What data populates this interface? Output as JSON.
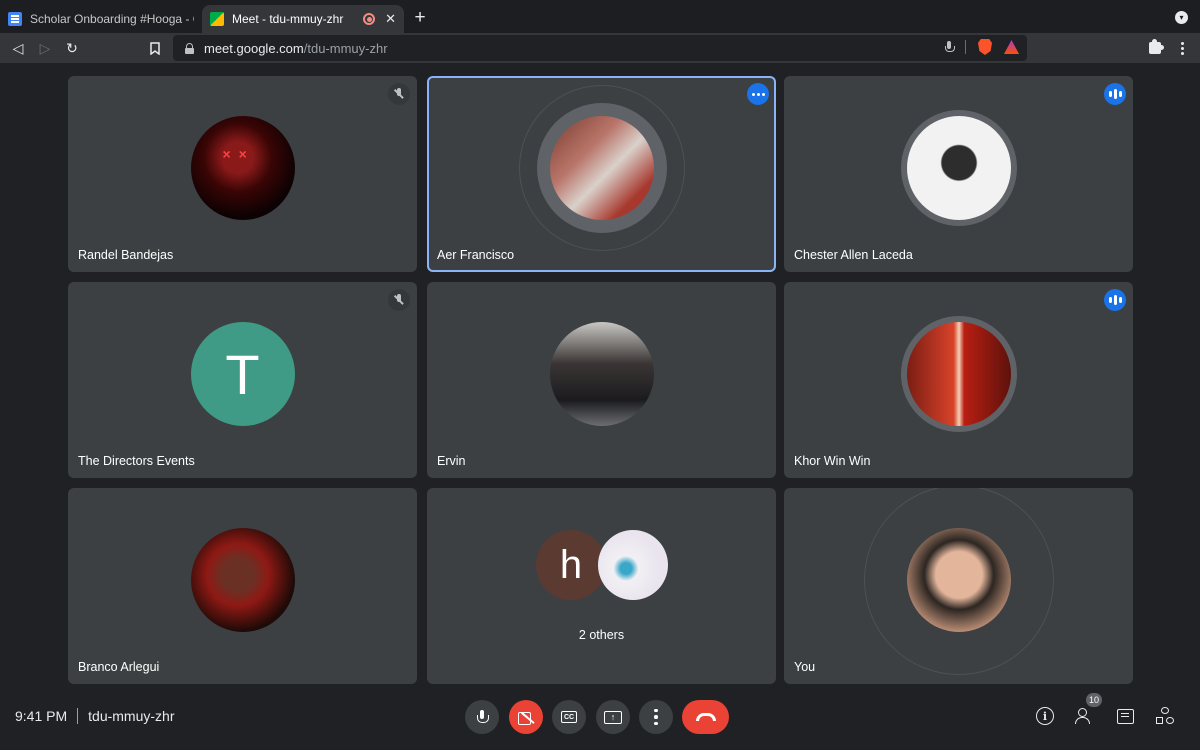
{
  "browser": {
    "tabs": [
      {
        "title": "Scholar Onboarding #Hooga - Goog",
        "icon": "google-docs-icon",
        "active": false
      },
      {
        "title": "Meet - tdu-mmuy-zhr",
        "icon": "google-meet-icon",
        "active": true,
        "close": "✕"
      }
    ],
    "new_tab": "+",
    "url": {
      "host": "meet.google.com",
      "path": "/tdu-mmuy-zhr"
    },
    "nav": {
      "back": "◁",
      "forward": "▷",
      "reload": "↻",
      "bookmark": "⊓"
    }
  },
  "participants": [
    {
      "name": "Randel Bandejas",
      "avatar": "photo",
      "status": "muted"
    },
    {
      "name": "Aer Francisco",
      "avatar": "photo",
      "status": "more",
      "speaking": true
    },
    {
      "name": "Chester Allen Laceda",
      "avatar": "photo",
      "status": "speaking-audio"
    },
    {
      "name": "The Directors Events",
      "avatar": "T",
      "avatar_color": "#3f9a86",
      "status": "muted"
    },
    {
      "name": "Ervin",
      "avatar": "photo",
      "status": "none"
    },
    {
      "name": "Khor Win Win",
      "avatar": "photo",
      "status": "speaking-audio"
    },
    {
      "name": "Branco Arlegui",
      "avatar": "photo",
      "status": "none"
    },
    {
      "name": "2 others",
      "avatar": "h",
      "avatar_color": "#5b3a32",
      "status": "none"
    },
    {
      "name": "You",
      "avatar": "photo",
      "status": "none"
    }
  ],
  "bottom_bar": {
    "time": "9:41 PM",
    "meeting_code": "tdu-mmuy-zhr",
    "controls": [
      "mic-button",
      "camera-off-button",
      "captions-button",
      "present-button",
      "more-options-button",
      "hangup-button"
    ],
    "cc_label": "CC",
    "people_count": "10"
  },
  "colors": {
    "background": "#202124",
    "tile": "#3c4043",
    "accent_blue": "#1a73e8",
    "speaking_border": "#8ab4f8",
    "danger_red": "#ea4335"
  }
}
